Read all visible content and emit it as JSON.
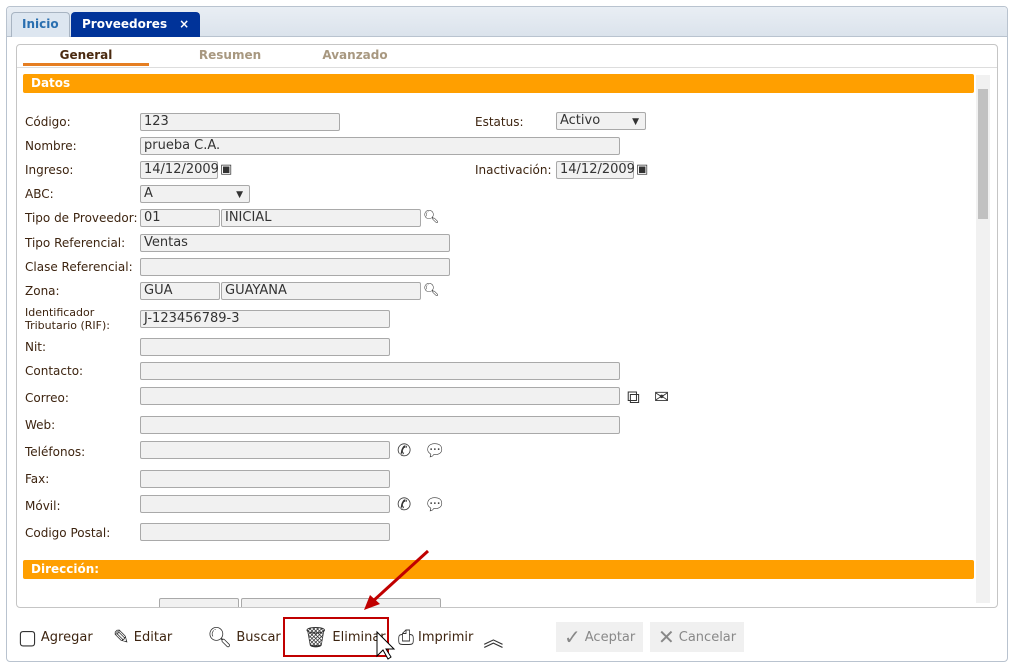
{
  "tabs": [
    {
      "label": "Inicio"
    },
    {
      "label": "Proveedores",
      "close": "×"
    }
  ],
  "subtabs": [
    "General",
    "Resumen",
    "Avanzado"
  ],
  "sections": {
    "datos": "Datos",
    "direccion": "Dirección:"
  },
  "form": {
    "codigo": {
      "label": "Código:",
      "value": "123"
    },
    "estatus": {
      "label": "Estatus:",
      "value": "Activo"
    },
    "nombre": {
      "label": "Nombre:",
      "value": "prueba C.A."
    },
    "ingreso": {
      "label": "Ingreso:",
      "value": "14/12/2009"
    },
    "inactivacion": {
      "label": "Inactivación:",
      "value": "14/12/2009"
    },
    "abc": {
      "label": "ABC:",
      "value": "A"
    },
    "tipo_proveedor": {
      "label": "Tipo de Proveedor:",
      "code": "01",
      "value": "INICIAL"
    },
    "tipo_referencial": {
      "label": "Tipo Referencial:",
      "value": "Ventas"
    },
    "clase_referencial": {
      "label": "Clase Referencial:",
      "value": ""
    },
    "zona": {
      "label": "Zona:",
      "code": "GUA",
      "value": "GUAYANA"
    },
    "rif": {
      "label1": "Identificador",
      "label2": "Tributario (RIF):",
      "value": "J-123456789-3"
    },
    "nit": {
      "label": "Nit:",
      "value": ""
    },
    "contacto": {
      "label": "Contacto:",
      "value": ""
    },
    "correo": {
      "label": "Correo:",
      "value": ""
    },
    "web": {
      "label": "Web:",
      "value": ""
    },
    "telefonos": {
      "label": "Teléfonos:",
      "value": ""
    },
    "fax": {
      "label": "Fax:",
      "value": ""
    },
    "movil": {
      "label": "Móvil:",
      "value": ""
    },
    "codigo_postal": {
      "label": "Codigo Postal:",
      "value": ""
    }
  },
  "toolbar": {
    "agregar": "Agregar",
    "editar": "Editar",
    "buscar": "Buscar",
    "eliminar": "Eliminar",
    "imprimir": "Imprimir",
    "aceptar": "Aceptar",
    "cancelar": "Cancelar"
  },
  "colors": {
    "accent": "#ff9f00",
    "tab_active": "#003399",
    "highlight": "#c00000"
  }
}
